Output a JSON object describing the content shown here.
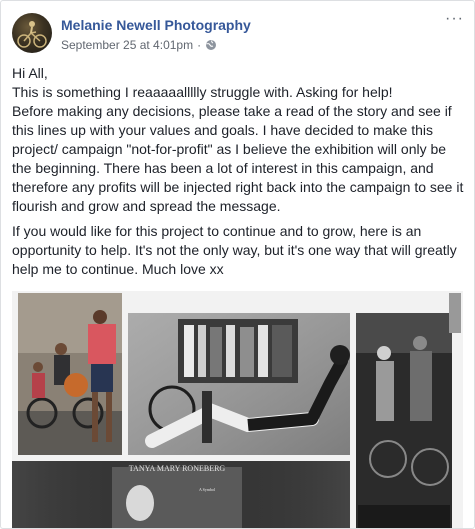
{
  "post": {
    "author": "Melanie Newell Photography",
    "timestamp": "September 25 at 4:01pm",
    "separator": "·",
    "audience_icon": "globe-icon",
    "more_icon": "more-options-icon",
    "more_label": "···"
  },
  "body": {
    "line1": "Hi All,",
    "line2": "This is something I reaaaaallllly struggle with. Asking for help!",
    "paragraph1": "Before making any decisions, please take a read of the story and see if this lines up with your values and goals. I have decided to make this project/ campaign \"not-for-profit\" as I believe the exhibition will only be the beginning. There has been a lot of interest in this campaign, and therefore any profits will be injected right back into the campaign to see it flourish and grow and spread the message.",
    "paragraph2": "If you would like for this project to continue and to grow, here is an opportunity to help. It's not the only way, but it's one way that will greatly help me to continue. Much love xx"
  },
  "image": {
    "plaque_name": "TANYA MARY RONEBERG",
    "plaque_text": "A Symbol of Happiness... of Strength... of Beauty... of How to Live our Lives"
  }
}
